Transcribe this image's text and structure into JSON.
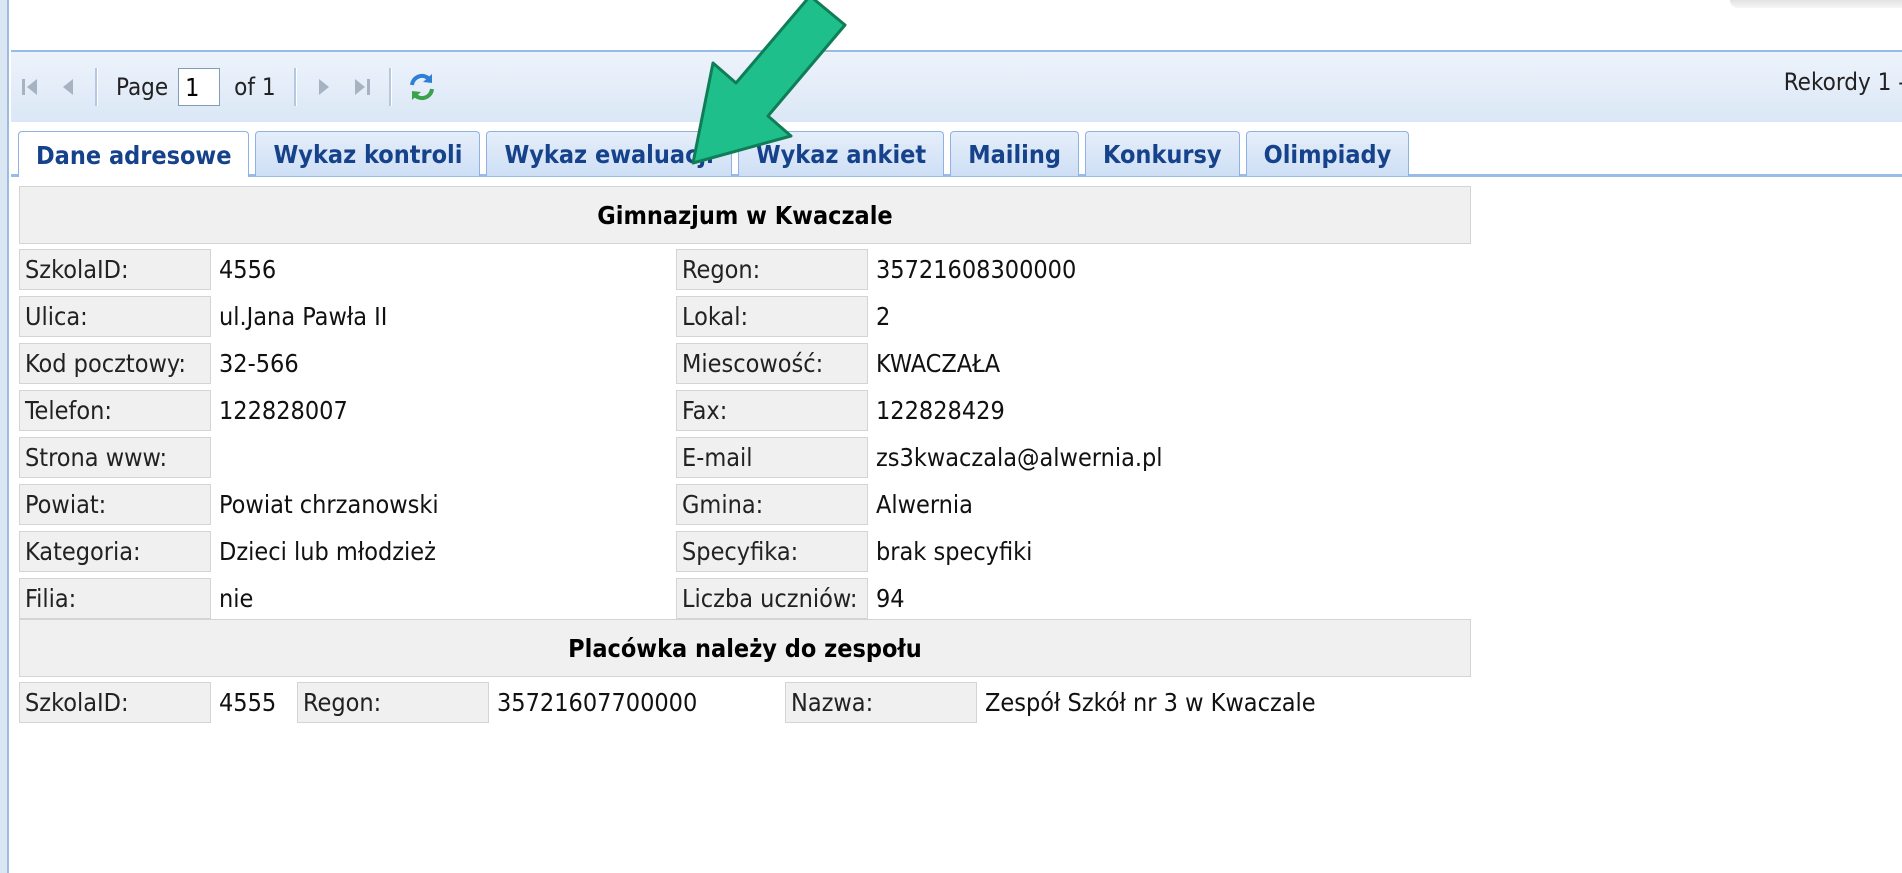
{
  "pager": {
    "page_label": "Page",
    "page_value": "1",
    "of_label": "of 1",
    "records": "Rekordy 1 -"
  },
  "tabs": [
    {
      "label": "Dane adresowe",
      "active": true
    },
    {
      "label": "Wykaz kontroli",
      "active": false
    },
    {
      "label": "Wykaz ewaluacji",
      "active": false
    },
    {
      "label": "Wykaz ankiet",
      "active": false
    },
    {
      "label": "Mailing",
      "active": false
    },
    {
      "label": "Konkursy",
      "active": false
    },
    {
      "label": "Olimpiady",
      "active": false
    }
  ],
  "school": {
    "title": "Gimnazjum w Kwaczale",
    "rows": [
      {
        "l1": "SzkolaID:",
        "v1": "4556",
        "l2": "Regon:",
        "v2": "35721608300000"
      },
      {
        "l1": "Ulica:",
        "v1": "ul.Jana Pawła II",
        "l2": "Lokal:",
        "v2": "2"
      },
      {
        "l1": "Kod pocztowy:",
        "v1": "32-566",
        "l2": "Miescowość:",
        "v2": "KWACZAŁA"
      },
      {
        "l1": "Telefon:",
        "v1": "122828007",
        "l2": "Fax:",
        "v2": "122828429"
      },
      {
        "l1": "Strona www:",
        "v1": "",
        "l2": "E-mail",
        "v2": "zs3kwaczala@alwernia.pl"
      },
      {
        "l1": "Powiat:",
        "v1": "Powiat chrzanowski",
        "l2": "Gmina:",
        "v2": "Alwernia"
      },
      {
        "l1": "Kategoria:",
        "v1": "Dzieci lub młodzież",
        "l2": "Specyfika:",
        "v2": "brak specyfiki"
      },
      {
        "l1": "Filia:",
        "v1": "nie",
        "l2": "Liczba uczniów:",
        "v2": "94"
      }
    ]
  },
  "group": {
    "title": "Placówka należy do zespołu",
    "id_label": "SzkolaID:",
    "id_value": "4555",
    "regon_label": "Regon:",
    "regon_value": "35721607700000",
    "name_label": "Nazwa:",
    "name_value": "Zespół Szkół nr 3 w Kwaczale"
  },
  "colors": {
    "tab_text": "#15428b",
    "arrow_fill": "#1fbf8c",
    "arrow_stroke": "#0f7d56"
  },
  "icons": {
    "first": "first-page-icon",
    "prev": "prev-page-icon",
    "next": "next-page-icon",
    "last": "last-page-icon",
    "refresh": "refresh-icon"
  }
}
